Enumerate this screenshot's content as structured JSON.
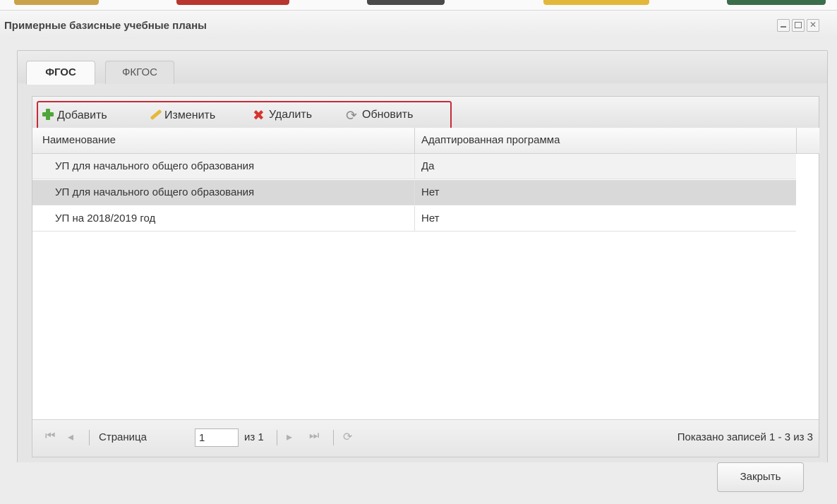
{
  "window": {
    "title": "Примерные базисные учебные планы"
  },
  "tabs": [
    {
      "label": "ФГОС",
      "active": true
    },
    {
      "label": "ФКГОС",
      "active": false
    }
  ],
  "toolbar": {
    "add_label": "Добавить",
    "edit_label": "Изменить",
    "delete_label": "Удалить",
    "refresh_label": "Обновить",
    "highlight_color": "#c72a3a"
  },
  "grid": {
    "columns": [
      "Наименование",
      "Адаптированная программа"
    ],
    "rows": [
      {
        "name": "УП для начального общего образования",
        "adapted": "Да"
      },
      {
        "name": "УП для начального общего образования",
        "adapted": "Нет"
      },
      {
        "name": "УП на 2018/2019 год",
        "adapted": "Нет"
      }
    ],
    "selected_row": 1
  },
  "pager": {
    "page_label": "Страница",
    "page_value": "1",
    "of_label": "из 1",
    "summary": "Показано записей 1 - 3 из 3"
  },
  "footer": {
    "close_label": "Закрыть"
  }
}
